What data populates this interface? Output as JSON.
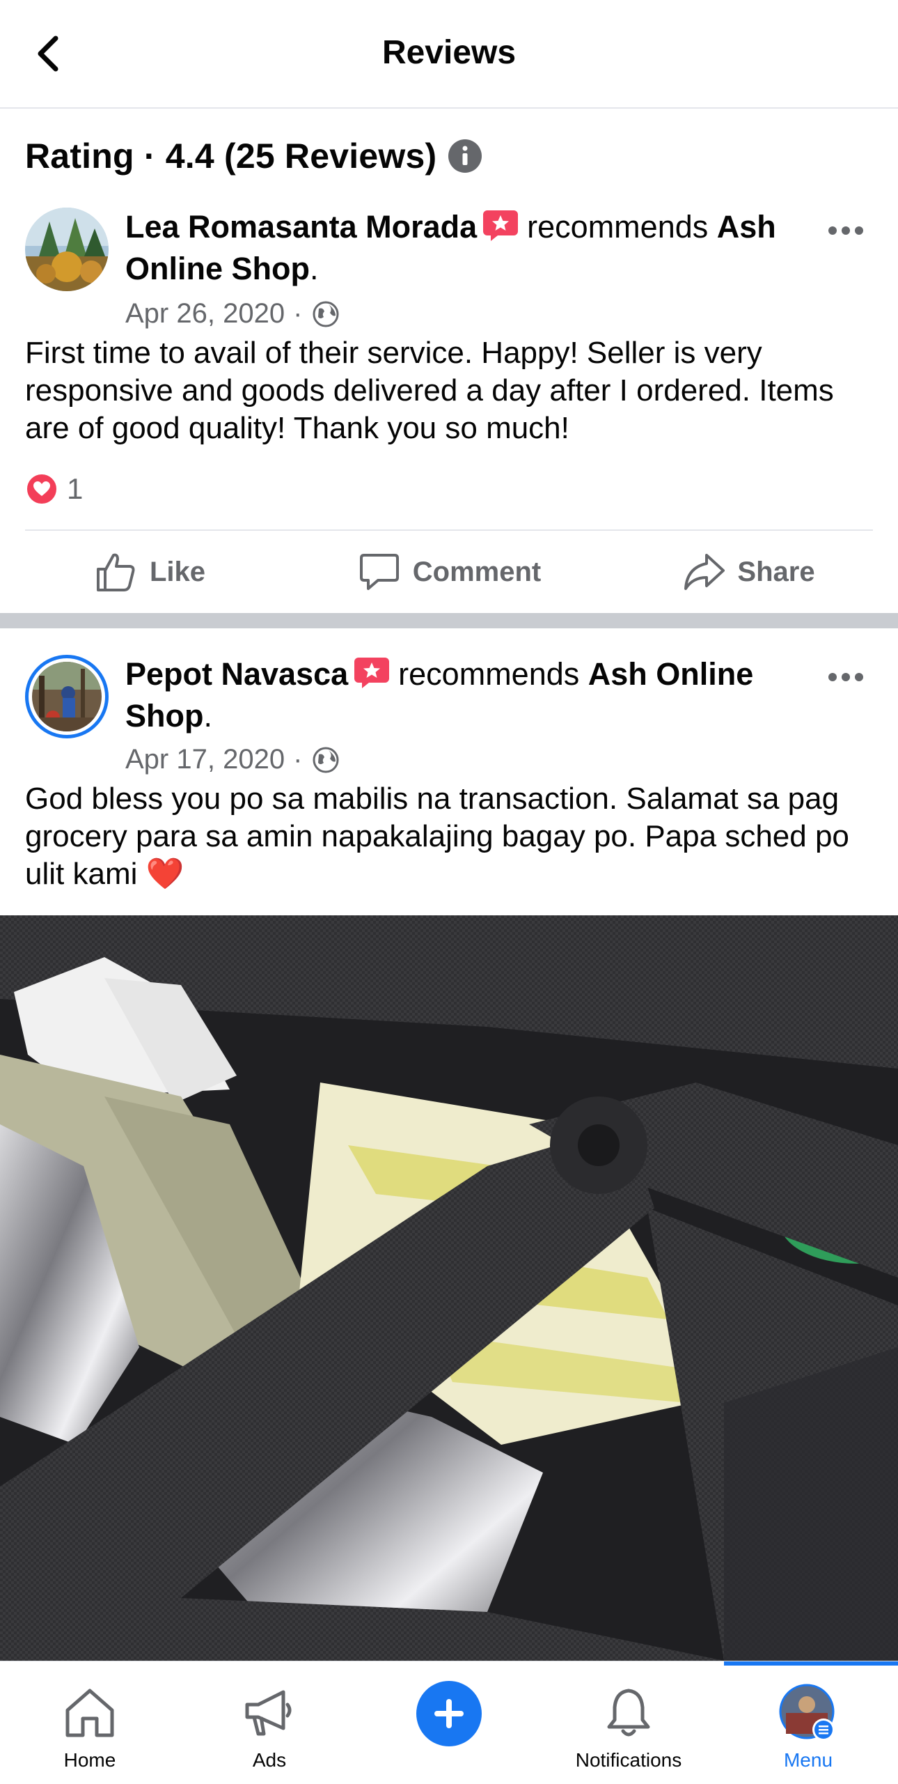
{
  "header": {
    "title": "Reviews"
  },
  "rating": {
    "text": "Rating · 4.4 (25 Reviews)"
  },
  "reviews": [
    {
      "author": "Lea Romasanta Morada",
      "verb": "recommends",
      "page": "Ash Online Shop",
      "date": "Apr 26, 2020",
      "separator": "·",
      "text": "First time to avail of their service. Happy! Seller is very responsive and goods delivered a day after I ordered. Items are of good quality! Thank you so much!",
      "reaction_count": "1"
    },
    {
      "author": "Pepot Navasca",
      "verb": "recommends",
      "page": "Ash Online Shop",
      "date": "Apr 17, 2020",
      "separator": "·",
      "text": "God bless you po sa mabilis na transaction. Salamat sa pag grocery para sa amin napakalajing bagay po. Papa sched po ulit kami",
      "emoji": "❤️"
    }
  ],
  "actions": {
    "like": "Like",
    "comment": "Comment",
    "share": "Share"
  },
  "tabbar": {
    "home": "Home",
    "ads": "Ads",
    "notifications": "Notifications",
    "menu": "Menu"
  },
  "colors": {
    "accent": "#1877f2",
    "heart": "#f33e58",
    "recommend_badge": "#f3425f"
  },
  "icons": [
    "back-arrow-icon",
    "info-icon",
    "recommend-star-icon",
    "more-icon",
    "globe-icon",
    "heart-icon",
    "like-icon",
    "comment-icon",
    "share-icon",
    "home-icon",
    "megaphone-icon",
    "plus-icon",
    "bell-icon",
    "menu-icon"
  ]
}
